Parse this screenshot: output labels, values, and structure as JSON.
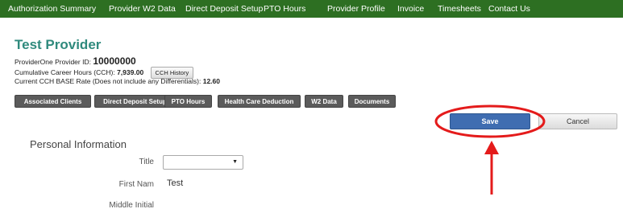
{
  "nav": {
    "items": [
      {
        "label": "Authorization Summary"
      },
      {
        "label": "Provider W2 Data"
      },
      {
        "label": "Direct Deposit Setup"
      },
      {
        "label": "PTO Hours"
      },
      {
        "label": "Provider Profile"
      },
      {
        "label": "Invoice"
      },
      {
        "label": "Timesheets"
      },
      {
        "label": "Contact Us"
      }
    ]
  },
  "provider": {
    "name": "Test Provider",
    "id_label": "ProviderOne Provider ID:",
    "id_value": "10000000",
    "cch_label": "Cumulative Career Hours (CCH):",
    "cch_value": "7,939.00",
    "cch_history_label": "CCH History",
    "rate_label": "Current CCH BASE Rate (Does not include any Differentials):",
    "rate_value": "12.60"
  },
  "tabs": [
    {
      "label": "Associated Clients"
    },
    {
      "label": "Direct Deposit Setup"
    },
    {
      "label": "PTO Hours"
    },
    {
      "label": "Health Care Deduction"
    },
    {
      "label": "W2 Data"
    },
    {
      "label": "Documents"
    }
  ],
  "actions": {
    "save_label": "Save",
    "cancel_label": "Cancel"
  },
  "form": {
    "section_title": "Personal Information",
    "title_label": "Title",
    "title_value": "",
    "first_name_label": "First Nam",
    "first_name_value": "Test",
    "middle_initial_label": "Middle Initial"
  },
  "colors": {
    "nav_bg": "#2d6f22",
    "title": "#2f8a7d",
    "save_bg": "#3f6db1",
    "annotation": "#e41b1b"
  },
  "icons": {
    "select_caret": "▼"
  }
}
